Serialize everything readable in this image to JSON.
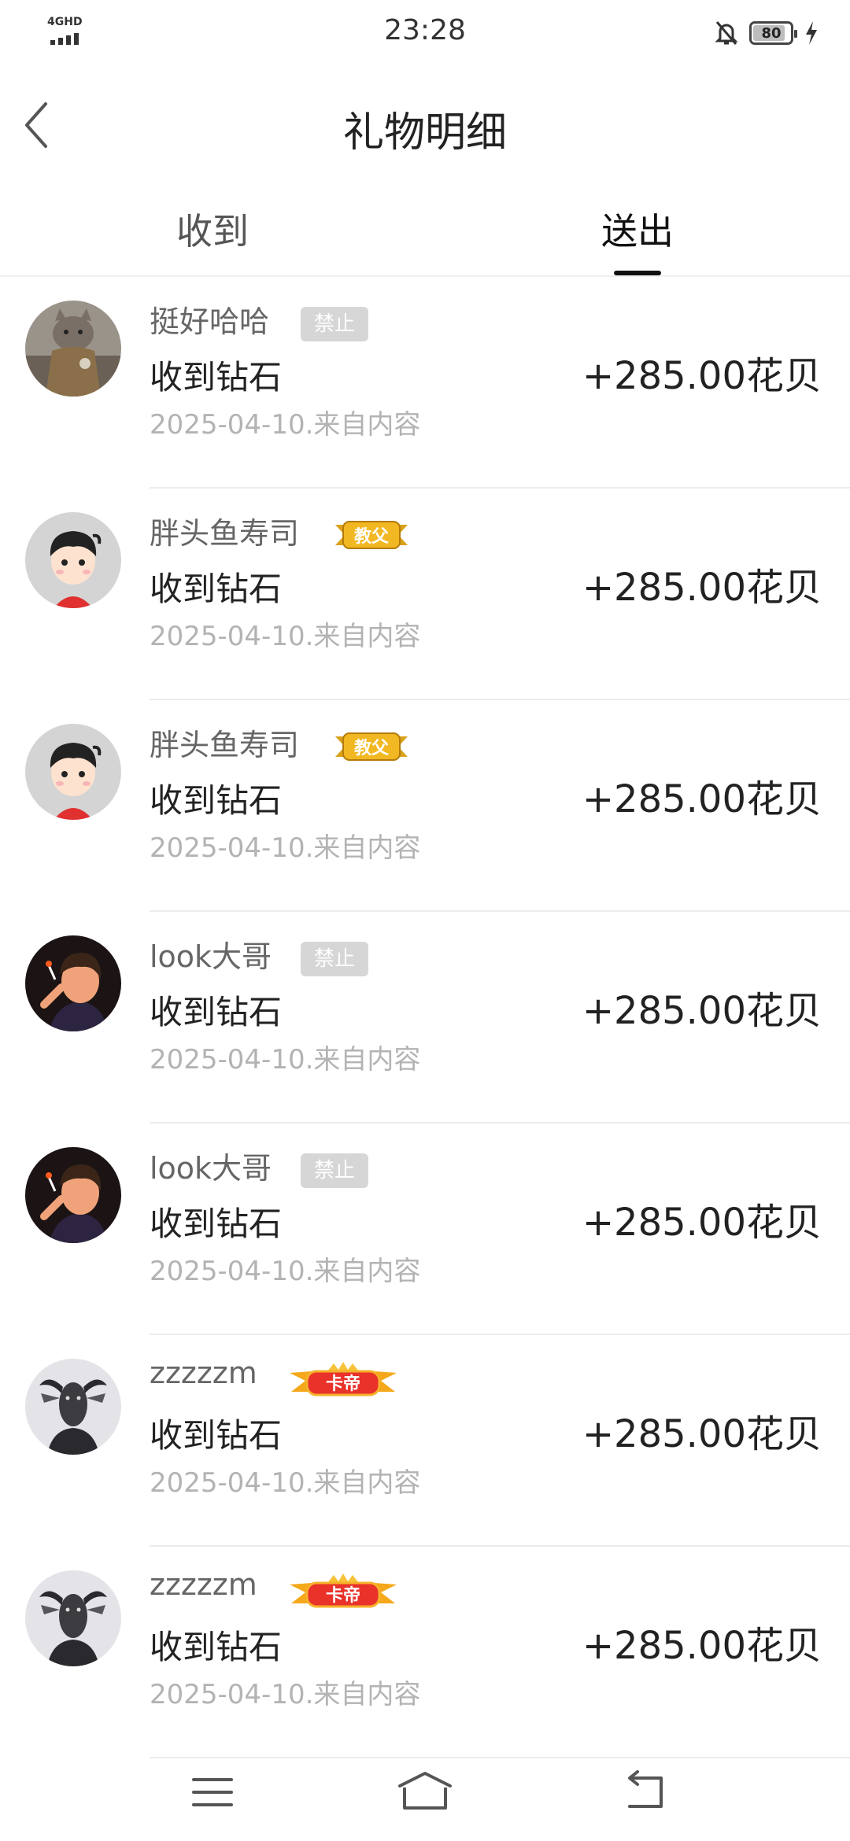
{
  "status_bar": {
    "network": "4GHD",
    "time": "23:28",
    "battery": "80"
  },
  "header": {
    "title": "礼物明细"
  },
  "tabs": [
    {
      "label": "收到",
      "selected": false
    },
    {
      "label": "送出",
      "selected": true
    }
  ],
  "records": [
    {
      "username": "挺好哈哈",
      "badge": {
        "type": "ban",
        "text": "禁止"
      },
      "avatar": "cat-in-jacket-avatar",
      "description": "收到钻石",
      "date": "2025-04-10.来自内容",
      "amount": "+285.00花贝"
    },
    {
      "username": "胖头鱼寿司",
      "badge": {
        "type": "medal",
        "text": "教父"
      },
      "avatar": "cartoon-boy-avatar",
      "description": "收到钻石",
      "date": "2025-04-10.来自内容",
      "amount": "+285.00花贝"
    },
    {
      "username": "胖头鱼寿司",
      "badge": {
        "type": "medal",
        "text": "教父"
      },
      "avatar": "cartoon-boy-avatar",
      "description": "收到钻石",
      "date": "2025-04-10.来自内容",
      "amount": "+285.00花贝"
    },
    {
      "username": "look大哥",
      "badge": {
        "type": "ban",
        "text": "禁止"
      },
      "avatar": "anime-smoker-avatar",
      "description": "收到钻石",
      "date": "2025-04-10.来自内容",
      "amount": "+285.00花贝"
    },
    {
      "username": "look大哥",
      "badge": {
        "type": "ban",
        "text": "禁止"
      },
      "avatar": "anime-smoker-avatar",
      "description": "收到钻石",
      "date": "2025-04-10.来自内容",
      "amount": "+285.00花贝"
    },
    {
      "username": "zzzzzm",
      "badge": {
        "type": "crown",
        "text": "卡帝"
      },
      "avatar": "goat-mask-avatar",
      "description": "收到钻石",
      "date": "2025-04-10.来自内容",
      "amount": "+285.00花贝"
    },
    {
      "username": "zzzzzm",
      "badge": {
        "type": "crown",
        "text": "卡帝"
      },
      "avatar": "goat-mask-avatar",
      "description": "收到钻石",
      "date": "2025-04-10.来自内容",
      "amount": "+285.00花贝"
    }
  ],
  "system_nav": {
    "icons": [
      "menu-icon",
      "home-icon",
      "back-icon"
    ]
  }
}
